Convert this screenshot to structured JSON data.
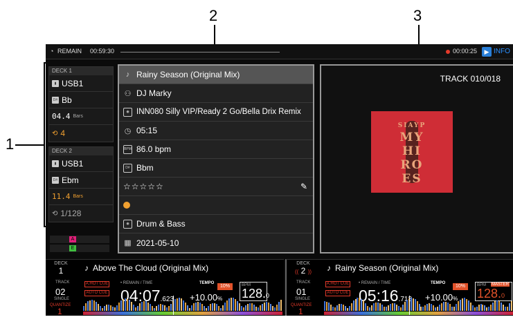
{
  "callouts": [
    "1",
    "2",
    "3"
  ],
  "topbar": {
    "remain_label": "REMAIN",
    "remain_time": "00:59:30",
    "rec_time": "00:00:25",
    "info_label": "INFO"
  },
  "deck1": {
    "header": "DECK 1",
    "source": "USB1",
    "key": "Bb",
    "bars_value": "04.4",
    "bars_unit": "Bars",
    "loop": "4"
  },
  "deck2": {
    "header": "DECK 2",
    "source": "USB1",
    "key": "Ebm",
    "bars_value": "11.4",
    "bars_unit": "Bars",
    "loop": "1/128"
  },
  "track_info": {
    "title": "Rainy Season (Original Mix)",
    "artist": "DJ Marky",
    "album": "INN080 Silly VIP/Ready 2 Go/Bella Drix Remix",
    "duration": "05:15",
    "bpm": "86.0 bpm",
    "key": "Bbm",
    "rating": "☆☆☆☆☆",
    "genre": "Drum & Bass",
    "date": "2021-05-10",
    "color_dot": "#f0a030"
  },
  "artwork": {
    "track_counter": "TRACK 010/018",
    "cover_text_1": "SIAYP",
    "cover_text_2": "MY",
    "cover_text_3": "HI",
    "cover_text_4": "RO",
    "cover_text_5": "ES",
    "cover_color": "#cf2d36"
  },
  "hotcues": {
    "a_label": "A",
    "a_color": "#e0207a",
    "e_label": "E",
    "e_color": "#3fbf3f"
  },
  "bottom_deck1": {
    "deck_label": "DECK",
    "deck_num": "1",
    "title": "Above The Cloud (Original Mix)",
    "track_label": "TRACK",
    "track_num": "02",
    "mode": "SINGLE",
    "quantize_label": "QUANTIZE",
    "quantize_val": "1",
    "hot_cue": "A.HOT CUE",
    "auto_cue": "AUTO CUE",
    "remain_time_label": "• REMAIN / TIME",
    "time_main": "04:07",
    "time_frac": ".623",
    "tempo_label": "TEMPO",
    "tempo_range": "10%",
    "tempo_value": "+10.00",
    "tempo_unit": "%",
    "bpm_label": "BPM",
    "bpm_value": "128.",
    "bpm_decimal": "0"
  },
  "bottom_deck2": {
    "deck_label": "DECK",
    "deck_num": "2",
    "title": "Rainy Season (Original Mix)",
    "track_label": "TRACK",
    "track_num": "01",
    "mode": "SINGLE",
    "quantize_label": "QUANTIZE",
    "quantize_val": "1",
    "hot_cue": "A.HOT CUE",
    "auto_cue": "AUTO CUE",
    "remain_time_label": "• REMAIN / TIME",
    "time_main": "05:16",
    "time_frac": ".713",
    "tempo_label": "TEMPO",
    "tempo_range": "10%",
    "tempo_value": "+10.00",
    "tempo_unit": "%",
    "bpm_label": "BPM",
    "master_label": "MASTER",
    "bpm_value": "128.",
    "bpm_decimal": "0"
  }
}
